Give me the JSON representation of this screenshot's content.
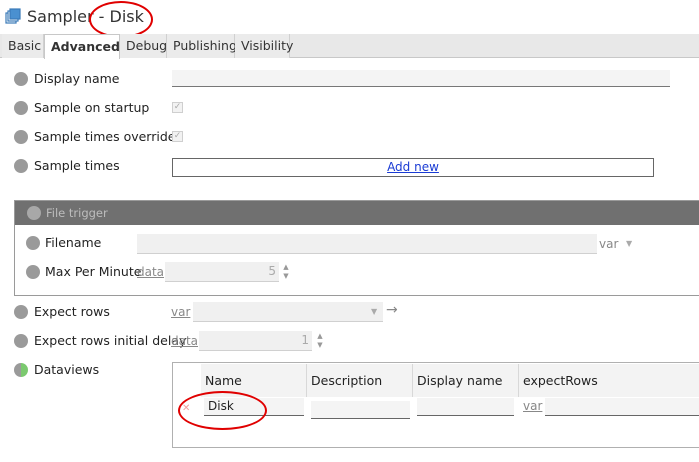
{
  "title": {
    "name": "Sampler",
    "separator": " - ",
    "entity": "Disk"
  },
  "tabs": [
    "Basic",
    "Advanced",
    "Debug",
    "Publishing",
    "Visibility"
  ],
  "active_tab": "Advanced",
  "fields": {
    "display_name": {
      "label": "Display name",
      "value": ""
    },
    "sample_on_startup": {
      "label": "Sample on startup",
      "checked": true
    },
    "sample_times_override": {
      "label": "Sample times override",
      "checked": true
    },
    "sample_times": {
      "label": "Sample times",
      "add_label": "Add new"
    },
    "file_trigger": {
      "title": "File trigger",
      "filename": {
        "label": "Filename",
        "mode": "var",
        "value": ""
      },
      "max_per_minute": {
        "label": "Max Per Minute",
        "mode": "data",
        "value": "5"
      }
    },
    "expect_rows": {
      "label": "Expect rows",
      "mode": "var",
      "value": ""
    },
    "expect_rows_initial_delay": {
      "label": "Expect rows initial delay",
      "mode": "data",
      "value": "1"
    },
    "dataviews": {
      "label": "Dataviews",
      "columns": [
        "Name",
        "Description",
        "Display name",
        "expectRows"
      ],
      "rows": [
        {
          "name": "Disk",
          "description": "",
          "display_name": "",
          "expect_rows_mode": "var",
          "expect_rows": ""
        }
      ]
    }
  },
  "annotations": {
    "color": "#e00000"
  },
  "icons": {
    "title_icon": "sampler-stack-icon",
    "arrow": "right-arrow-icon",
    "dropdown": "chevron-down-icon"
  }
}
